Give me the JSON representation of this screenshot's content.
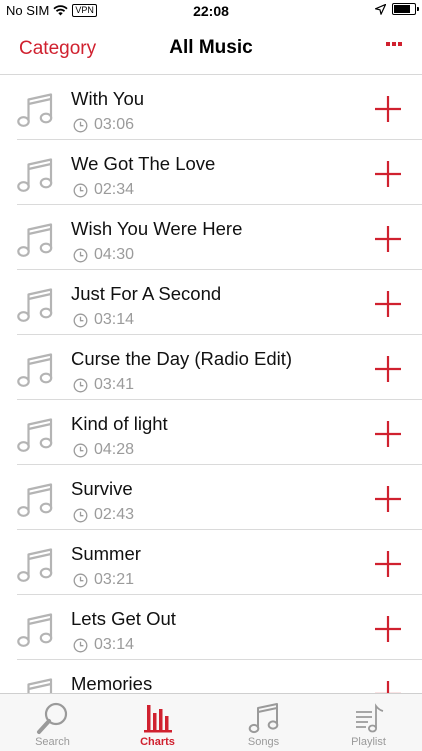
{
  "status_bar": {
    "carrier": "No SIM",
    "vpn": "VPN",
    "time": "22:08",
    "battery_level": 0.8
  },
  "nav": {
    "left_label": "Category",
    "title": "All Music"
  },
  "songs": [
    {
      "title": "With You",
      "duration": "03:06"
    },
    {
      "title": "We Got The Love",
      "duration": "02:34"
    },
    {
      "title": "Wish You Were Here",
      "duration": "04:30"
    },
    {
      "title": "Just For A Second",
      "duration": "03:14"
    },
    {
      "title": "Curse the Day (Radio Edit)",
      "duration": "03:41"
    },
    {
      "title": "Kind of light",
      "duration": "04:28"
    },
    {
      "title": "Survive",
      "duration": "02:43"
    },
    {
      "title": "Summer",
      "duration": "03:21"
    },
    {
      "title": "Lets Get Out",
      "duration": "03:14"
    },
    {
      "title": "Memories",
      "duration": ""
    }
  ],
  "tabs": [
    {
      "label": "Search",
      "icon": "search-icon",
      "active": false
    },
    {
      "label": "Charts",
      "icon": "charts-icon",
      "active": true
    },
    {
      "label": "Songs",
      "icon": "music-note-icon",
      "active": false
    },
    {
      "label": "Playlist",
      "icon": "playlist-icon",
      "active": false
    }
  ],
  "colors": {
    "accent": "#d0212f",
    "muted": "#9b9b9b",
    "icon_gray": "#b4b4b4"
  }
}
